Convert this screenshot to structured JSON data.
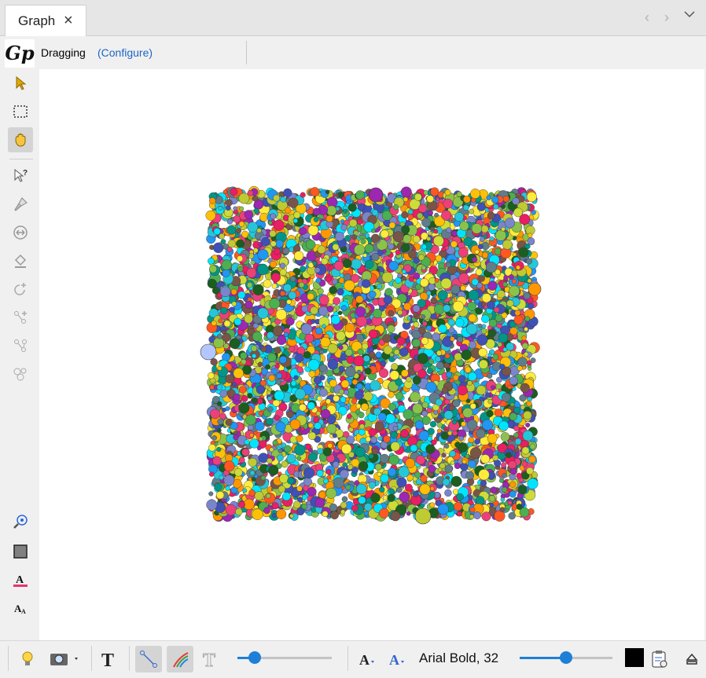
{
  "tab": {
    "title": "Graph",
    "close": "×"
  },
  "nav": {
    "prev": "‹",
    "next": "›",
    "menu": "⌄"
  },
  "status": {
    "mode": "Dragging",
    "configure": "(Configure)"
  },
  "logo": {
    "text": "Gp"
  },
  "left_tools": [
    {
      "icon": "pointer-icon",
      "active": false
    },
    {
      "icon": "rectangle-select-icon",
      "active": false
    },
    {
      "icon": "hand-drag-icon",
      "active": true
    },
    {
      "icon": "edit-pointer-icon",
      "active": false
    },
    {
      "icon": "brush-icon",
      "active": false
    },
    {
      "icon": "resize-icon",
      "active": false
    },
    {
      "icon": "paint-bucket-icon",
      "active": false
    },
    {
      "icon": "rotate-add-icon",
      "active": false
    },
    {
      "icon": "add-edge-icon",
      "active": false
    },
    {
      "icon": "node-connect-icon",
      "active": false
    },
    {
      "icon": "cluster-icon",
      "active": false
    },
    {
      "icon": "zoom-center-icon",
      "active": false
    },
    {
      "icon": "background-color-icon",
      "active": false
    },
    {
      "icon": "label-color-icon",
      "active": false
    },
    {
      "icon": "label-size-icon",
      "active": false
    }
  ],
  "bottom": {
    "font_label": "Arial Bold, 32",
    "edge_scale_slider": 0.18,
    "font_scale_slider": 0.5,
    "color": "#000000"
  },
  "graph": {
    "node_colors": [
      "#00e5ff",
      "#ff9800",
      "#9c27b0",
      "#4caf50",
      "#ffeb3b",
      "#e91e63",
      "#795548",
      "#2196f3",
      "#8bc34a",
      "#3f51b5",
      "#cddc39",
      "#009688",
      "#ff5722",
      "#607d8b",
      "#ffc107",
      "#1b5e20",
      "#7986cb",
      "#26c6da",
      "#c0ca33",
      "#ec407a"
    ],
    "accent": "#1e7fd6"
  }
}
